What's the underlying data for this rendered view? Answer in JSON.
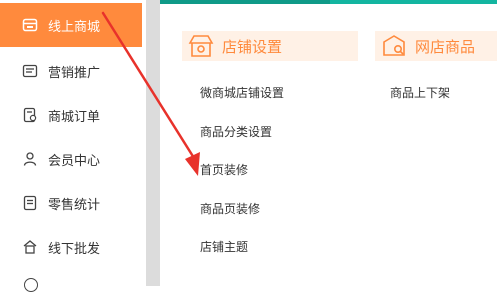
{
  "sidebar": {
    "items": [
      {
        "label": "线上商城",
        "icon": "store-icon",
        "active": true
      },
      {
        "label": "营销推广",
        "icon": "promotion-icon"
      },
      {
        "label": "商城订单",
        "icon": "order-icon"
      },
      {
        "label": "会员中心",
        "icon": "member-icon"
      },
      {
        "label": "零售统计",
        "icon": "statistics-icon"
      },
      {
        "label": "线下批发",
        "icon": "wholesale-icon"
      }
    ]
  },
  "panels": [
    {
      "title": "店铺设置",
      "icon": "shop-settings-icon",
      "links": [
        "微商城店铺设置",
        "商品分类设置",
        "首页装修",
        "商品页装修",
        "店铺主题"
      ]
    },
    {
      "title": "网店商品",
      "icon": "online-goods-icon",
      "links": [
        "商品上下架"
      ]
    }
  ],
  "colors": {
    "accent": "#ff8a3d",
    "panel_head_bg": "#fff1e6",
    "top_bar": "#13b5a0",
    "arrow": "#e8322b"
  }
}
